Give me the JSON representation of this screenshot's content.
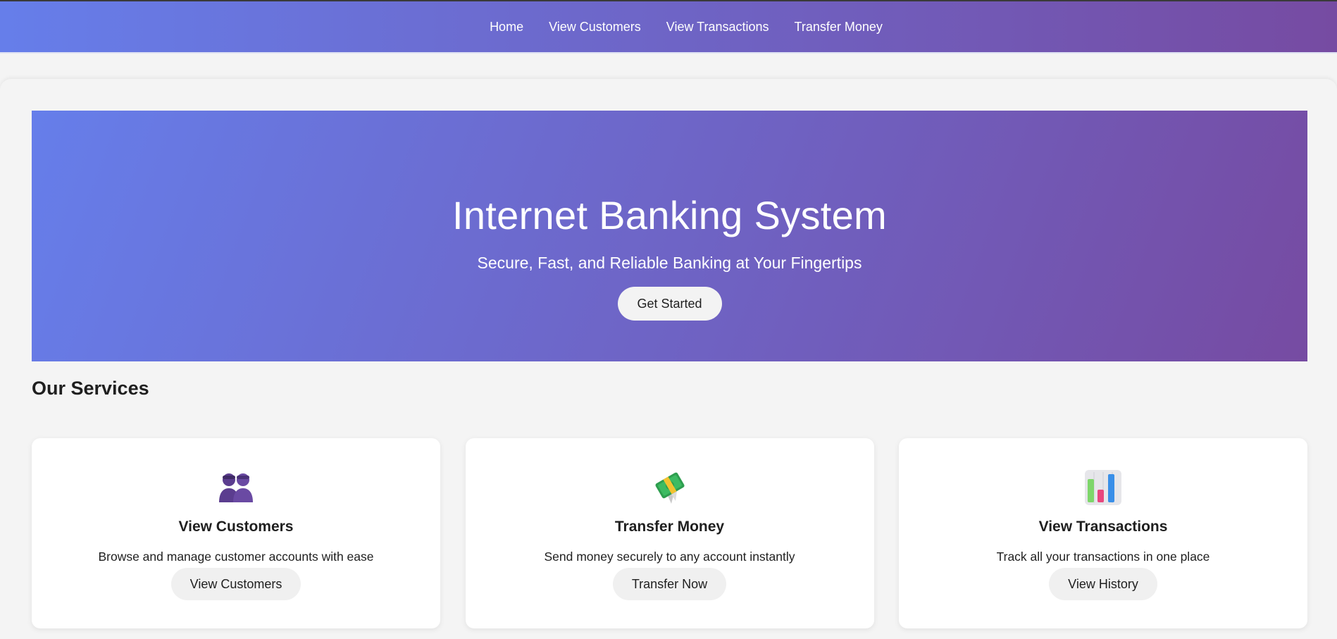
{
  "nav": {
    "items": [
      {
        "label": "Home"
      },
      {
        "label": "View Customers"
      },
      {
        "label": "View Transactions"
      },
      {
        "label": "Transfer Money"
      }
    ]
  },
  "hero": {
    "title": "Internet Banking System",
    "subtitle": "Secure, Fast, and Reliable Banking at Your Fingertips",
    "button_label": "Get Started"
  },
  "services": {
    "title": "Our Services",
    "cards": [
      {
        "icon": "two-people-icon",
        "title": "View Customers",
        "description": "Browse and manage customer accounts with ease",
        "button_label": "View Customers"
      },
      {
        "icon": "money-with-wings-icon",
        "title": "Transfer Money",
        "description": "Send money securely to any account instantly",
        "button_label": "Transfer Now"
      },
      {
        "icon": "bar-chart-icon",
        "title": "View Transactions",
        "description": "Track all your transactions in one place",
        "button_label": "View History"
      }
    ]
  },
  "colors": {
    "gradient_start": "#667eea",
    "gradient_end": "#764ba2",
    "page_background": "#f4f4f4",
    "card_background": "#ffffff"
  }
}
